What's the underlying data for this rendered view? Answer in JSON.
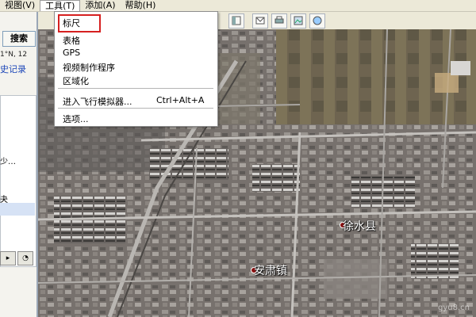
{
  "menubar": {
    "items": [
      {
        "label": "视图(V)"
      },
      {
        "label": "工具(T)"
      },
      {
        "label": "添加(A)"
      },
      {
        "label": "帮助(H)"
      }
    ]
  },
  "tools_menu": {
    "items": [
      {
        "label": "标尺",
        "highlighted": true
      },
      {
        "label": "表格"
      },
      {
        "label": "GPS"
      },
      {
        "label": "视频制作程序"
      },
      {
        "label": "区域化"
      },
      {
        "label": "进入飞行模拟器...",
        "shortcut": "Ctrl+Alt+A"
      },
      {
        "label": "选项..."
      }
    ],
    "highlight_color": "#d62020"
  },
  "sidebar": {
    "search_button": "搜索",
    "coordinates_text": "1°N, 12",
    "history_link": "史记录",
    "place_1": "少…",
    "place_2": "夬"
  },
  "map": {
    "labels": [
      {
        "text": "徐水县"
      },
      {
        "text": "安肃镇"
      }
    ],
    "watermark": "gyu8.cn"
  },
  "colors": {
    "menu_bg": "#ece9d8",
    "link": "#1a45b8",
    "map_base": "#6f6a66"
  }
}
